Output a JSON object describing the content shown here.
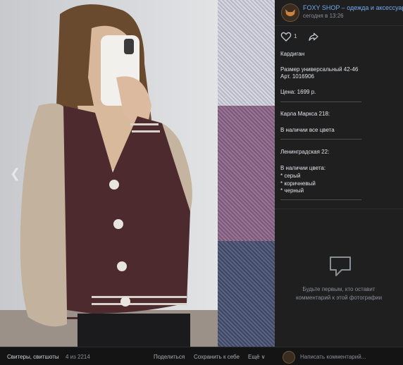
{
  "post": {
    "group_name": "FOXY SHOP – одежда и аксессуары",
    "date": "сегодня в 13:26",
    "likes": "1"
  },
  "description": {
    "title": "Кардиган",
    "size": "Размер универсальный 42-46",
    "article": "Арт. 1016906",
    "price": "Цена: 1699 р.",
    "store1_address": "Карла Маркса 218:",
    "store1_stock": "В наличии все цвета",
    "store2_address": "Ленинградская 22:",
    "store2_stock_label": "В наличии цвета:",
    "colors": [
      "* серый",
      "* коричневый",
      "* черный"
    ]
  },
  "comments": {
    "empty_line1": "Будьте первым, кто оставит",
    "empty_line2": "комментарий к этой фотографии"
  },
  "bottom": {
    "album": "Свитеры, свитшоты",
    "counter": "4 из 2214",
    "share": "Поделиться",
    "save": "Сохранить к себе",
    "more": "Ещё ∨",
    "comment_placeholder": "Написать комментарий..."
  },
  "colors": {
    "link": "#71aaeb",
    "panel_bg": "#1f1f20",
    "page_bg": "#19191a",
    "swatch_grey": "#c7c7d2",
    "swatch_pink": "#8c6a88",
    "swatch_blue": "#4a5370"
  }
}
